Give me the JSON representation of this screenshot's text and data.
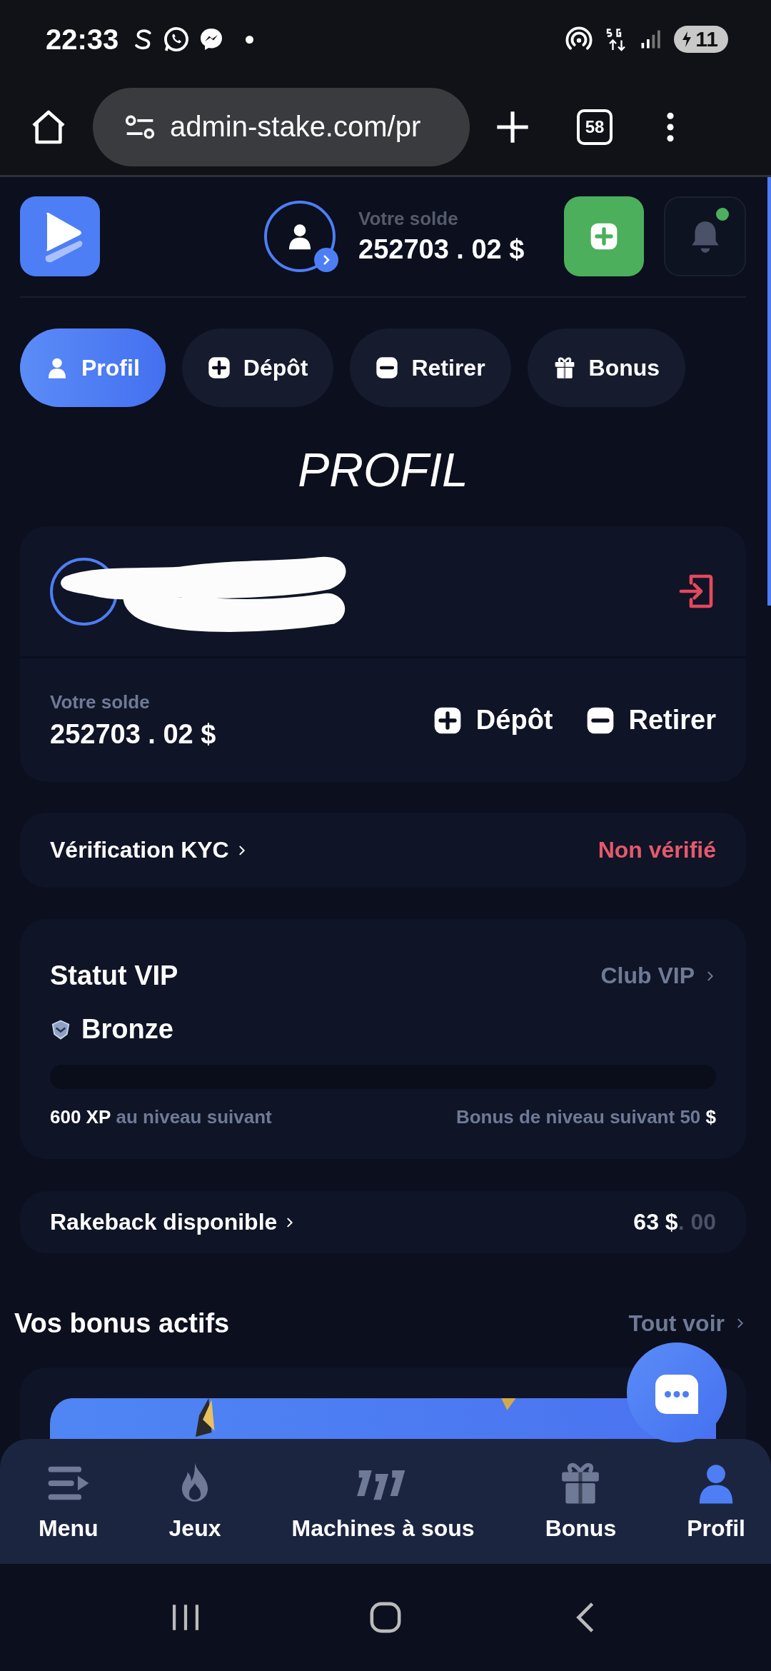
{
  "status_bar": {
    "time": "22:33",
    "battery": "11"
  },
  "browser": {
    "url": "admin-stake.com/pr",
    "tab_count": "58"
  },
  "header": {
    "balance_label": "Votre solde",
    "balance": "252703 . 02 $"
  },
  "tabs": [
    {
      "label": "Profil",
      "kind": "user",
      "selected": true
    },
    {
      "label": "Dépôt",
      "kind": "plus",
      "selected": false
    },
    {
      "label": "Retirer",
      "kind": "minus",
      "selected": false
    },
    {
      "label": "Bonus",
      "kind": "gift",
      "selected": false
    }
  ],
  "title": "PROFIL",
  "profile_card": {
    "balance_label": "Votre solde",
    "balance": "252703 . 02 $",
    "actions": [
      {
        "label": "Dépôt",
        "kind": "plus"
      },
      {
        "label": "Retirer",
        "kind": "minus"
      }
    ]
  },
  "kyc": {
    "label": "Vérification KYC",
    "status": "Non vérifié",
    "verified": false
  },
  "vip": {
    "title": "Statut VIP",
    "link": "Club VIP",
    "tier": "Bronze",
    "level": 0,
    "xp": "600 XP",
    "xp_suffix": "au niveau suivant",
    "bonus_text": "Bonus de niveau suivant 50",
    "bonus_currency": "$"
  },
  "rakeback": {
    "label": "Rakeback disponible",
    "amount": "63 $",
    "cents": ". 00"
  },
  "bonus_section": {
    "title": "Vos bonus actifs",
    "link": "Tout voir"
  },
  "bottom_nav": [
    {
      "label": "Menu",
      "kind": "menu",
      "selected": false
    },
    {
      "label": "Jeux",
      "kind": "fire",
      "selected": false
    },
    {
      "label": "Machines à sous",
      "kind": "slots",
      "selected": false
    },
    {
      "label": "Bonus",
      "kind": "gift",
      "selected": false
    },
    {
      "label": "Profil",
      "kind": "user",
      "selected": true
    }
  ]
}
